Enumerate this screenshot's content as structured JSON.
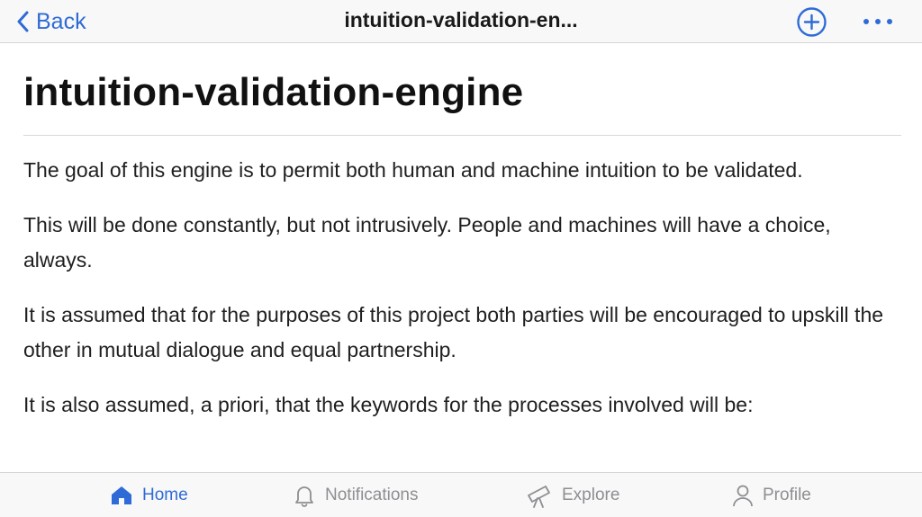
{
  "nav": {
    "back_label": "Back",
    "title": "intuition-validation-en...",
    "accent_color": "#2f6bd6"
  },
  "page": {
    "heading": "intuition-validation-engine",
    "paragraphs": [
      "The goal of this engine is to permit both human and machine intuition to be validated.",
      "This will be done constantly, but not intrusively. People and machines will have a choice, always.",
      "It is assumed that for the purposes of this project both parties will be encouraged to upskill the other in mutual dialogue and equal partnership.",
      "It is also assumed, a priori, that the keywords for the processes involved will be:"
    ]
  },
  "tabs": [
    {
      "label": "Home",
      "icon": "home-icon",
      "active": true
    },
    {
      "label": "Notifications",
      "icon": "bell-icon",
      "active": false
    },
    {
      "label": "Explore",
      "icon": "telescope-icon",
      "active": false
    },
    {
      "label": "Profile",
      "icon": "person-icon",
      "active": false
    }
  ]
}
